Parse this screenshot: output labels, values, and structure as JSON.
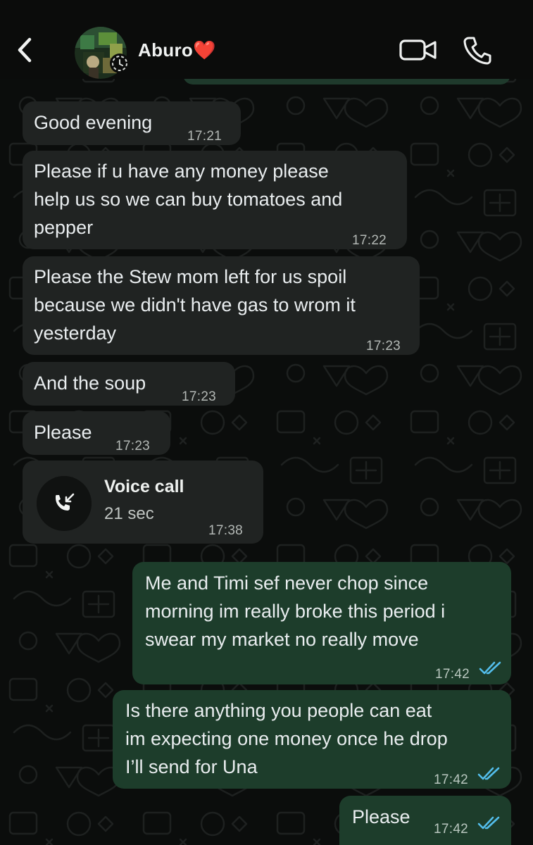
{
  "header": {
    "contact_name": "Aburo❤️",
    "icons": [
      "back-icon",
      "avatar",
      "video-call-icon",
      "phone-icon"
    ]
  },
  "messages": [
    {
      "direction": "incoming",
      "text": "Good evening",
      "time": "17:21"
    },
    {
      "direction": "incoming",
      "lines": [
        "Please if u have any money please",
        "help us so we can buy tomatoes and",
        "pepper"
      ],
      "time": "17:22"
    },
    {
      "direction": "incoming",
      "lines": [
        "Please the Stew mom left for us spoil",
        "because we didn't have gas to wrom it",
        "yesterday"
      ],
      "time": "17:23"
    },
    {
      "direction": "incoming",
      "text": "And the soup",
      "time": "17:23"
    },
    {
      "direction": "incoming",
      "text": "Please",
      "time": "17:23"
    },
    {
      "direction": "incoming",
      "type": "call",
      "title": "Voice call",
      "duration": "21 sec",
      "time": "17:38",
      "icon": "incoming-call-icon"
    },
    {
      "direction": "outgoing",
      "lines": [
        "Me and Timi sef never chop since",
        "morning im really broke this period i",
        "swear my market no really move"
      ],
      "time": "17:42",
      "status": "read"
    },
    {
      "direction": "outgoing",
      "lines": [
        "Is there anything you people can eat",
        "im expecting one money once he drop",
        "I’ll send for Una"
      ],
      "time": "17:42",
      "status": "read"
    },
    {
      "direction": "outgoing",
      "text": "Please",
      "time": "17:42",
      "status": "read"
    }
  ],
  "colors": {
    "background": "#0b0d0c",
    "incoming_bubble": "#202322",
    "outgoing_bubble": "#1d3d2b",
    "read_ticks": "#53bdeb",
    "heart": "#e0322b"
  }
}
